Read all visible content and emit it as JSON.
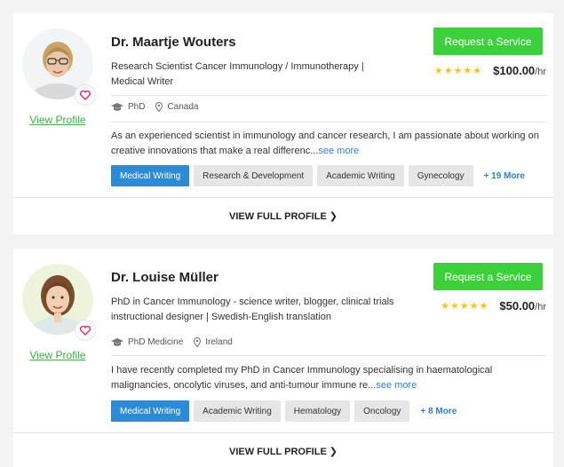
{
  "experts": [
    {
      "name": "Dr. Maartje Wouters",
      "title": "Research Scientist Cancer Immunology / Immunotherapy | Medical Writer",
      "request_label": "Request a Service",
      "stars": "★★★★★",
      "price": "$100.00",
      "price_unit": "/hr",
      "degree": "PhD",
      "location": "Canada",
      "description": "As an experienced scientist in immunology and cancer research, I am passionate about working on creative innovations that make a real differenc...",
      "see_more": "see more",
      "tags": [
        "Medical Writing",
        "Research & Development",
        "Academic Writing",
        "Gynecology"
      ],
      "more_tags": "+ 19 More",
      "view_profile": "View Profile",
      "view_full_profile": "VIEW FULL PROFILE",
      "rating": 5
    },
    {
      "name": "Dr. Louise Müller",
      "title": "PhD in Cancer Immunology - science writer, blogger, clinical trials instructional designer | Swedish-English translation",
      "request_label": "Request a Service",
      "stars": "★★★★★",
      "price": "$50.00",
      "price_unit": "/hr",
      "degree": "PhD Medicine",
      "location": "Ireland",
      "description": "I have recently completed my PhD in Cancer Immunology specialising in haematological malignancies, oncolytic viruses, and anti-tumour immune re...",
      "see_more": "see more",
      "tags": [
        "Medical Writing",
        "Academic Writing",
        "Hematology",
        "Oncology"
      ],
      "more_tags": "+ 8 More",
      "view_profile": "View Profile",
      "view_full_profile": "VIEW FULL PROFILE",
      "rating": 5
    }
  ],
  "icons": {
    "degree": "graduation-cap-icon",
    "location": "map-pin-icon",
    "favorite": "heart-icon",
    "chevron": "chevron-right-icon"
  },
  "colors": {
    "accent_green": "#3cd13c",
    "link_green": "#3cb043",
    "tag_blue": "#2d8bd5",
    "link_blue": "#2f7fd1",
    "star": "#f5c518",
    "heart": "#e0245e"
  }
}
